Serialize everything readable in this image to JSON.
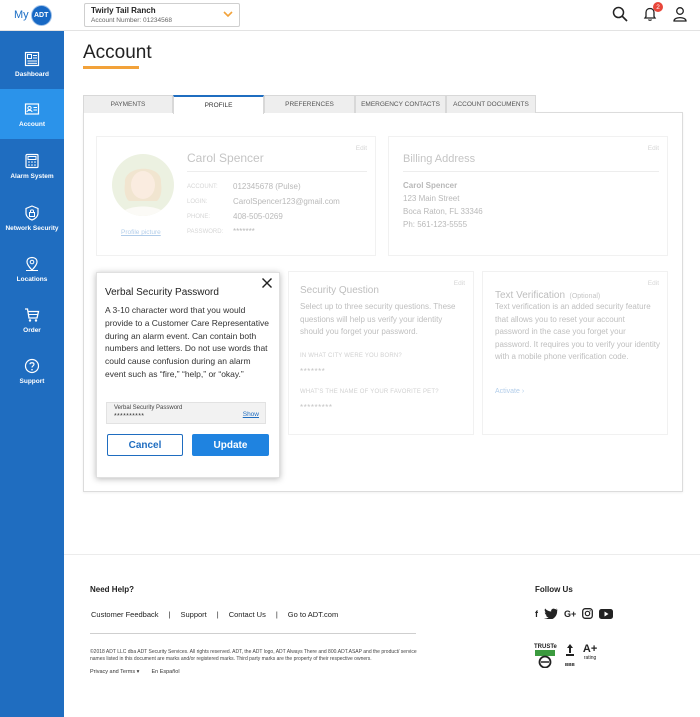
{
  "header": {
    "logo_my": "My",
    "logo_brand": "ADT",
    "account_name": "Twirly Tail Ranch",
    "account_number": "Account Number: 01234568",
    "notification_count": "2"
  },
  "sidebar": {
    "items": [
      {
        "label": "Dashboard",
        "icon": "dashboard-icon"
      },
      {
        "label": "Account",
        "icon": "account-card-icon",
        "active": true
      },
      {
        "label": "Alarm System",
        "icon": "alarm-keypad-icon"
      },
      {
        "label": "Network Security",
        "icon": "lock-shield-icon"
      },
      {
        "label": "Locations",
        "icon": "location-pin-icon"
      },
      {
        "label": "Order",
        "icon": "cart-icon"
      },
      {
        "label": "Support",
        "icon": "question-icon"
      }
    ]
  },
  "page": {
    "title": "Account"
  },
  "tabs": [
    {
      "label": "PAYMENTS"
    },
    {
      "label": "PROFILE",
      "active": true
    },
    {
      "label": "PREFERENCES"
    },
    {
      "label": "EMERGENCY CONTACTS"
    },
    {
      "label": "ACCOUNT DOCUMENTS"
    }
  ],
  "profile": {
    "edit": "Edit",
    "name": "Carol Spencer",
    "photo_link": "Profile picture",
    "fields": [
      {
        "label": "ACCOUNT:",
        "value": "012345678 (Pulse)"
      },
      {
        "label": "LOGIN:",
        "value": "CarolSpencer123@gmail.com"
      },
      {
        "label": "PHONE:",
        "value": "408-505-0269"
      },
      {
        "label": "PASSWORD:",
        "value": "*******"
      }
    ]
  },
  "billing": {
    "edit": "Edit",
    "title": "Billing Address",
    "name": "Carol Spencer",
    "street": "123 Main Street",
    "city": "Boca Raton, FL 33346",
    "phone": "Ph: 561-123-5555"
  },
  "security_question": {
    "edit": "Edit",
    "title": "Security Question",
    "description": "Select up to three security questions. These questions will help us verify your identity should you forget your password.",
    "q1": "IN WHAT CITY WERE YOU BORN?",
    "a1": "*******",
    "q2": "WHAT'S THE NAME OF YOUR FAVORITE PET?",
    "a2": "*********"
  },
  "text_verification": {
    "edit": "Edit",
    "title": "Text Verification",
    "optional": "(Optional)",
    "description": "Text verification is an added security feature that allows you to reset your account password in the case you forget your password. It requires you to verify your identity with a mobile phone verification code.",
    "activate": "Activate ›"
  },
  "popup": {
    "title": "Verbal Security Password",
    "text": "A 3-10 character word that you would provide to a Customer Care Representative during an alarm event. Can contain both numbers and letters. Do not use words that could cause confusion during an alarm event such as “fire,” “help,” or “okay.”",
    "field_label": "Verbal Security Password",
    "field_value": "**********",
    "show": "Show",
    "cancel": "Cancel",
    "update": "Update"
  },
  "footer": {
    "need_help": "Need Help?",
    "links": [
      "Customer Feedback",
      "Support",
      "Contact Us",
      "Go to ADT.com"
    ],
    "separator": "|",
    "legal": "©2018 ADT LLC dba ADT Security Services. All rights reserved. ADT, the ADT logo, ADT Always There and 800.ADT.ASAP and the product/ service names listed in this document are marks and/or registered marks. Third party marks are the property of their respective owners.",
    "privacy": "Privacy and Terms ▾",
    "espanol": "En Español",
    "follow_us": "Follow Us",
    "badge_truste": "TRUSTe",
    "badge_bbb": "BBB",
    "badge_rating": "A+",
    "badge_rating_label": "rating"
  },
  "colors": {
    "sidebar": "#1f6dc0",
    "sidebar_active": "#2b93ea",
    "accent_underline": "#f2a23a",
    "button_primary": "#1f83e0"
  }
}
